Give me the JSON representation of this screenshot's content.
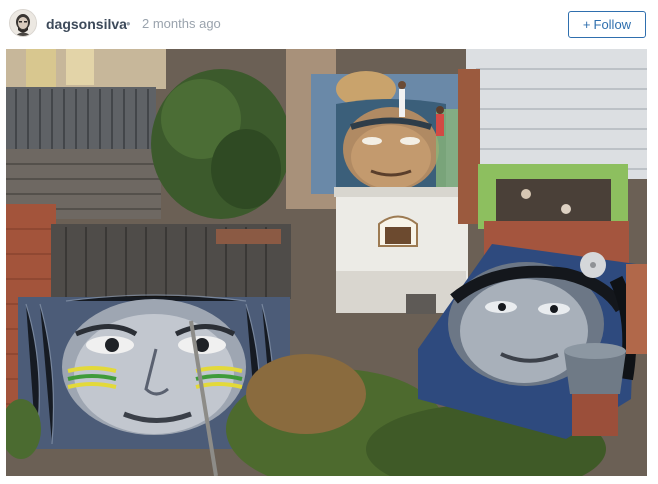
{
  "post": {
    "username": "dagsonsilva",
    "separator": "•",
    "timestamp": "2 months ago",
    "follow": {
      "icon": "+",
      "label": "Follow"
    },
    "accent_color": "#2f6fae"
  }
}
